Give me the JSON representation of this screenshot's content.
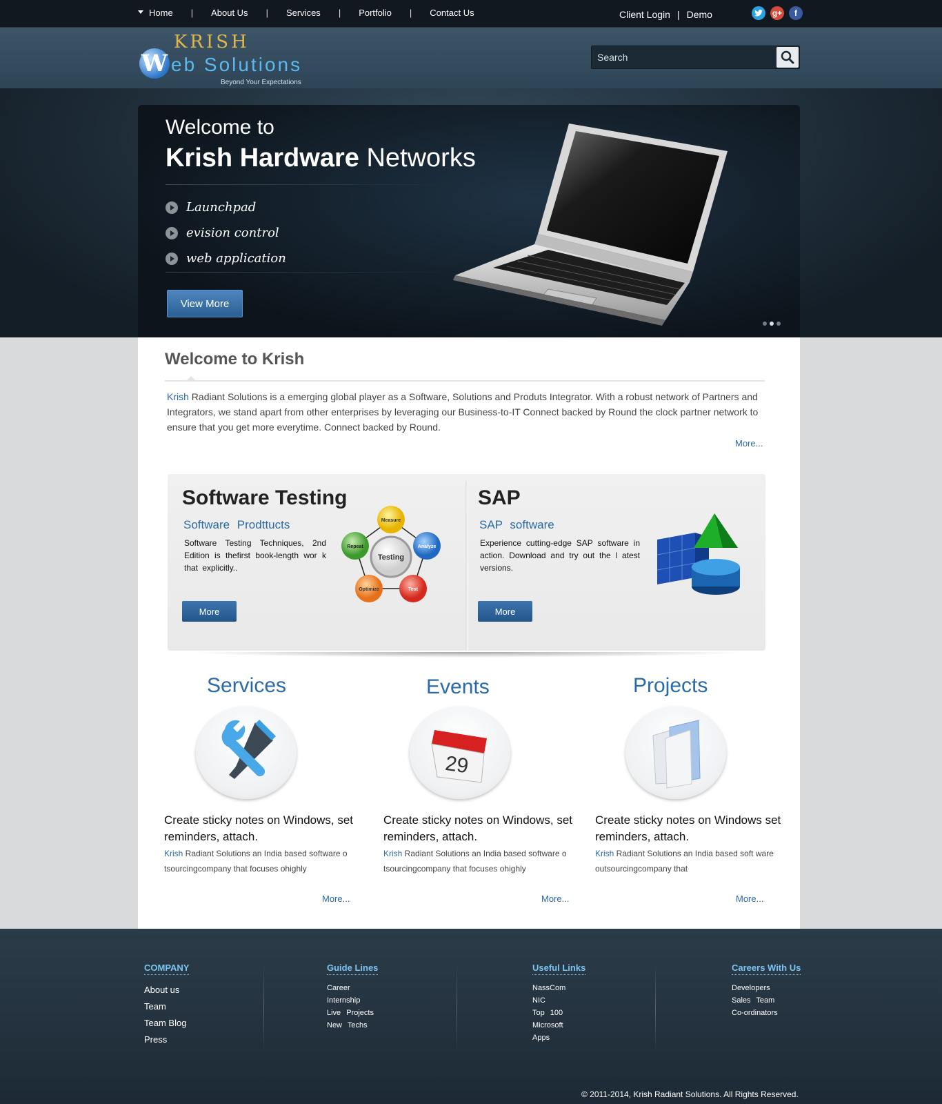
{
  "nav": {
    "items": [
      "Home",
      "About Us",
      "Services",
      "Portfolio",
      "Contact Us"
    ],
    "separator": "|",
    "client_login": "Client Login",
    "demo": "Demo",
    "social": [
      "twitter-icon",
      "google-plus-icon",
      "facebook-icon"
    ]
  },
  "logo": {
    "line1": "KRISH",
    "w": "W",
    "line2": "eb Solutions",
    "tagline": "Beyond Your Expectations"
  },
  "search": {
    "placeholder": "Search"
  },
  "slider": {
    "welcome": "Welcome to",
    "title_bold": "Krish Hardware",
    "title_rest": " Networks",
    "bullets": [
      "Launchpad",
      "evision control",
      "web application"
    ],
    "button": "View More",
    "slide_count": 3,
    "active_slide": 2
  },
  "welcome": {
    "title": "Welcome to Krish",
    "lead": "Krish",
    "text": " Radiant Solutions is a emerging global player as a Software, Solutions and Produts Integrator. With a robust network of Partners and Integrators, we stand apart from other enterprises by leveraging our Business-to-IT Connect backed by Round the clock partner network to ensure that you get more everytime. Connect backed by Round.",
    "more": "More..."
  },
  "cards": [
    {
      "title": "Software Testing",
      "subtitle": "Software Prodttucts",
      "text": "Software Testing Techniques, 2nd Edition is thefirst book-length wor k that explicitly..",
      "button": "More",
      "diagram": {
        "center": "Testing",
        "nodes": [
          "Measure",
          "Analyze",
          "Test",
          "Optimize",
          "Repeat"
        ]
      }
    },
    {
      "title": "SAP",
      "subtitle": "SAP software",
      "text": "Experience cutting-edge SAP software in action. Download and try out the l atest versions.",
      "button": "More"
    }
  ],
  "columns": [
    {
      "title": "Services",
      "icon": "tools-icon",
      "heading": "Create sticky notes on Windows, set reminders, attach.",
      "lead": "Krish",
      "text": " Radiant Solutions  an India based software o tsourcingcompany that focuses ohighly",
      "more": "More..."
    },
    {
      "title": "Events",
      "icon": "calendar-icon",
      "calendar_day": "29",
      "heading": "Create sticky notes on Windows, set reminders, attach.",
      "lead": "Krish",
      "text": " Radiant Solutions  an India based software o tsourcingcompany that focuses ohighly",
      "more": "More..."
    },
    {
      "title": "Projects",
      "icon": "folder-icon",
      "heading": "Create sticky notes on Windows set reminders, attach.",
      "lead": "Krish",
      "text": " Radiant Solutions  an India based soft ware outsourcingcompany that",
      "more": "More..."
    }
  ],
  "footer": {
    "company": {
      "title": "COMPANY",
      "links": [
        "About us",
        "Team",
        "Team Blog",
        "Press"
      ]
    },
    "guidelines": {
      "title": "Guide Lines",
      "links": [
        "Career",
        "Internship",
        "Live Projects",
        "New Techs"
      ]
    },
    "useful": {
      "title": "Useful Links",
      "links": [
        "NassCom",
        "NIC",
        "Top 100",
        "Microsoft",
        "Apps"
      ]
    },
    "careers": {
      "title": "Careers With Us",
      "links": [
        "Developers",
        "Sales Team",
        "Co-ordinators"
      ]
    },
    "copyright": "© 2011-2014, Krish Radiant Solutions. All Rights Reserved."
  }
}
